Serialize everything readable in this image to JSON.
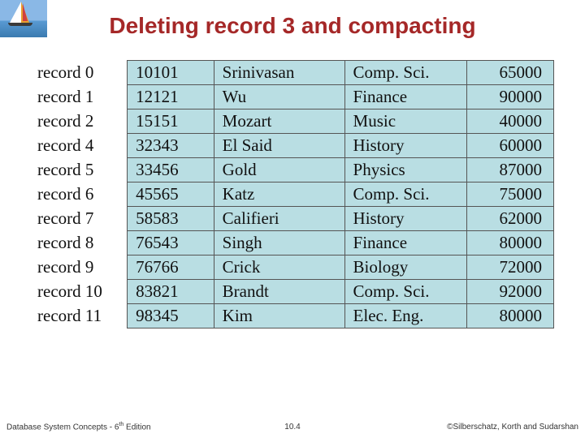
{
  "title": "Deleting record 3 and compacting",
  "rows": [
    {
      "label": "record 0",
      "id": "10101",
      "name": "Srinivasan",
      "dept": "Comp. Sci.",
      "salary": "65000"
    },
    {
      "label": "record 1",
      "id": "12121",
      "name": "Wu",
      "dept": "Finance",
      "salary": "90000"
    },
    {
      "label": "record 2",
      "id": "15151",
      "name": "Mozart",
      "dept": "Music",
      "salary": "40000"
    },
    {
      "label": "record 4",
      "id": "32343",
      "name": "El Said",
      "dept": "History",
      "salary": "60000"
    },
    {
      "label": "record 5",
      "id": "33456",
      "name": "Gold",
      "dept": "Physics",
      "salary": "87000"
    },
    {
      "label": "record 6",
      "id": "45565",
      "name": "Katz",
      "dept": "Comp. Sci.",
      "salary": "75000"
    },
    {
      "label": "record 7",
      "id": "58583",
      "name": "Califieri",
      "dept": "History",
      "salary": "62000"
    },
    {
      "label": "record 8",
      "id": "76543",
      "name": "Singh",
      "dept": "Finance",
      "salary": "80000"
    },
    {
      "label": "record 9",
      "id": "76766",
      "name": "Crick",
      "dept": "Biology",
      "salary": "72000"
    },
    {
      "label": "record 10",
      "id": "83821",
      "name": "Brandt",
      "dept": "Comp. Sci.",
      "salary": "92000"
    },
    {
      "label": "record 11",
      "id": "98345",
      "name": "Kim",
      "dept": "Elec. Eng.",
      "salary": "80000"
    }
  ],
  "footer": {
    "left_prefix": "Database System Concepts - 6",
    "left_suffix": " Edition",
    "left_sup": "th",
    "center": "10.4",
    "right": "©Silberschatz, Korth and Sudarshan"
  }
}
